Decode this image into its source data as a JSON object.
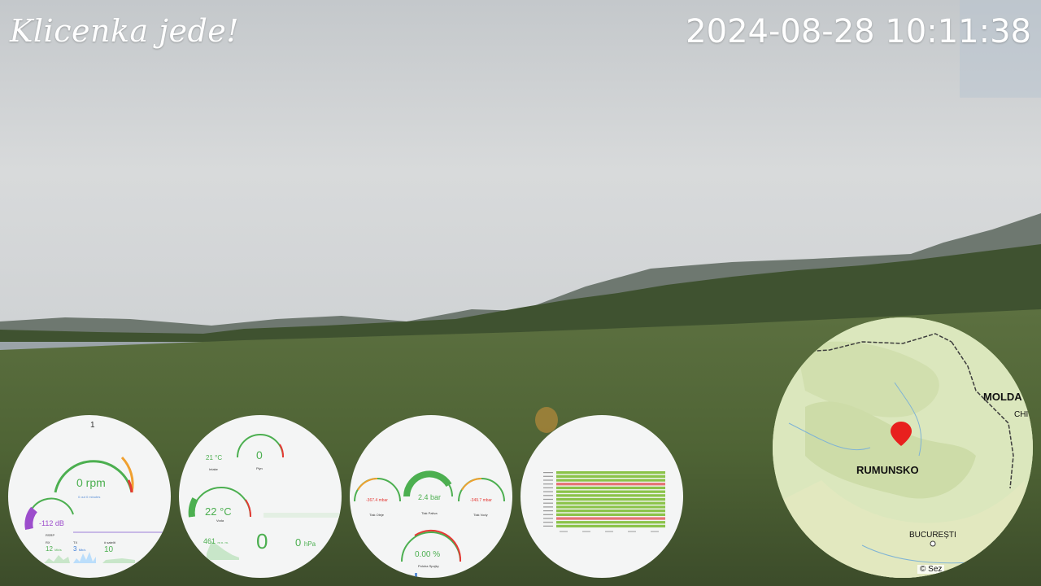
{
  "overlay": {
    "title": "Klicenka jede!",
    "datetime": "2024-08-28 10:11:38"
  },
  "engine_panel": {
    "top_label": "1",
    "rpm": "0 rpm",
    "rpm_sub": "0 out 0 minutes",
    "signal": "-112 dB",
    "signal_label": "RSRP",
    "rx_label": "RX",
    "rx_value": "12",
    "rx_unit": "Mb/s",
    "tx_label": "TX",
    "tx_value": "3",
    "tx_unit": "Mb/s",
    "sat_label": "# satelit",
    "sat_value": "10"
  },
  "env_panel": {
    "intake_value": "21 °C",
    "intake_label": "Intake",
    "gas_value": "0",
    "gas_label": "Plyn",
    "water_value": "22 °C",
    "water_label": "Voda",
    "altitude_value": "461",
    "altitude_unit": "m n. m.",
    "big_zero": "0",
    "pressure_value": "0",
    "pressure_unit": "hPa"
  },
  "pressure_panel": {
    "oil_value": "-367.4 mbar",
    "oil_label": "Tlak Oleje",
    "fuel_value": "2.4 bar",
    "fuel_label": "Tlak Paliva",
    "water_value": "-349.7 mbar",
    "water_label": "Tlak Vody",
    "clutch_value": "0.00 %",
    "clutch_label": "Poloha Spojky"
  },
  "status_panel": {
    "rows": [
      {
        "state": "ok"
      },
      {
        "state": "ok"
      },
      {
        "state": "ok"
      },
      {
        "state": "error"
      },
      {
        "state": "ok"
      },
      {
        "state": "ok"
      },
      {
        "state": "ok"
      },
      {
        "state": "ok"
      },
      {
        "state": "ok"
      },
      {
        "state": "ok"
      },
      {
        "state": "ok"
      },
      {
        "state": "ok"
      },
      {
        "state": "error"
      },
      {
        "state": "ok"
      },
      {
        "state": "ok"
      }
    ]
  },
  "map": {
    "country_label": "RUMUNSKO",
    "neighbor_label": "MOLDA",
    "neighbor_label2": "CHI",
    "city_label": "BUCUREȘTI",
    "attribution": "© Sez"
  },
  "colors": {
    "gauge_green": "#4caf50",
    "gauge_orange": "#f0a030",
    "gauge_red": "#e53935",
    "signal_purple": "#9c4dcc",
    "status_ok": "#8bc34a",
    "status_error": "#e57373",
    "pin_red": "#e8201e"
  }
}
